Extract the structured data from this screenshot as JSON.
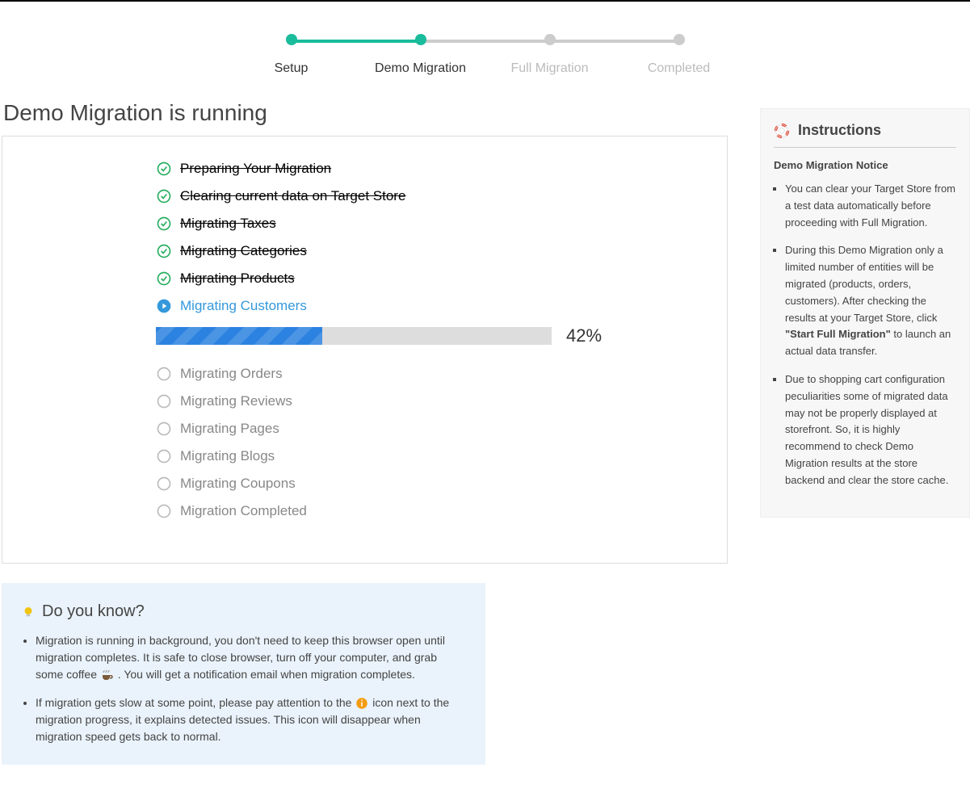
{
  "stepper": {
    "steps": [
      {
        "label": "Setup",
        "state": "done"
      },
      {
        "label": "Demo Migration",
        "state": "active"
      },
      {
        "label": "Full Migration",
        "state": "future"
      },
      {
        "label": "Completed",
        "state": "future"
      }
    ]
  },
  "page_title": "Demo Migration is running",
  "migration_steps": {
    "items": [
      {
        "label": "Preparing Your Migration",
        "state": "done"
      },
      {
        "label": "Clearing current data on Target Store",
        "state": "done"
      },
      {
        "label": "Migrating Taxes",
        "state": "done"
      },
      {
        "label": "Migrating Categories",
        "state": "done"
      },
      {
        "label": "Migrating Products",
        "state": "done"
      },
      {
        "label": "Migrating Customers",
        "state": "active"
      },
      {
        "label": "Migrating Orders",
        "state": "pending"
      },
      {
        "label": "Migrating Reviews",
        "state": "pending"
      },
      {
        "label": "Migrating Pages",
        "state": "pending"
      },
      {
        "label": "Migrating Blogs",
        "state": "pending"
      },
      {
        "label": "Migrating Coupons",
        "state": "pending"
      },
      {
        "label": "Migration Completed",
        "state": "pending"
      }
    ],
    "progress_pct": 42,
    "progress_label": "42%"
  },
  "instructions": {
    "title": "Instructions",
    "subtitle": "Demo Migration Notice",
    "bullets": {
      "b0": "You can clear your Target Store from a test data automatically before proceeding with Full Migration.",
      "b1_pre": "During this Demo Migration only a limited number of entities will be migrated (products, orders, customers). After checking the results at your Target Store, click ",
      "b1_strong": "\"Start Full Migration\"",
      "b1_post": " to launch an actual data transfer.",
      "b2": "Due to shopping cart configuration peculiarities some of migrated data may not be properly displayed at storefront. So, it is highly recommend to check Demo Migration results at the store backend and clear the store cache."
    }
  },
  "tips": {
    "title": "Do you know?",
    "t0_pre": "Migration is running in background, you don't need to keep this browser open until migration completes. It is safe to close browser, turn off your computer, and grab some coffee ",
    "t0_post": " . You will get a notification email when migration completes.",
    "t1_pre": "If migration gets slow at some point, please pay attention to the ",
    "t1_post": " icon next to the migration progress, it explains detected issues. This icon will disappear when migration speed gets back to normal."
  }
}
